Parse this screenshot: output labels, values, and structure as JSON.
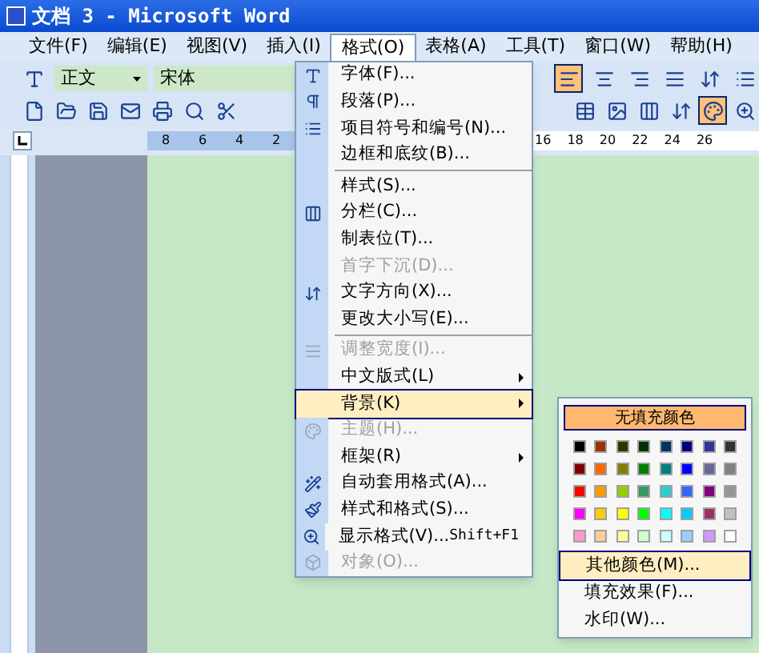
{
  "window": {
    "title": "文档 3 - Microsoft Word"
  },
  "menu_bar": [
    {
      "label": "文件(F)",
      "selected": false
    },
    {
      "label": "编辑(E)",
      "selected": false
    },
    {
      "label": "视图(V)",
      "selected": false
    },
    {
      "label": "插入(I)",
      "selected": false
    },
    {
      "label": "格式(O)",
      "selected": true
    },
    {
      "label": "表格(A)",
      "selected": false
    },
    {
      "label": "工具(T)",
      "selected": false
    },
    {
      "label": "窗口(W)",
      "selected": false
    },
    {
      "label": "帮助(H)",
      "selected": false
    }
  ],
  "formatting_toolbar": {
    "style": "正文",
    "font": "宋体"
  },
  "ruler": {
    "left_numbers": [
      "8",
      "6",
      "4",
      "2"
    ],
    "right_numbers": [
      "16",
      "18",
      "20",
      "22",
      "24",
      "26"
    ]
  },
  "format_menu": [
    {
      "kind": "item",
      "label": "字体(F)...",
      "disabled": false,
      "submenu": false,
      "selected": false
    },
    {
      "kind": "item",
      "label": "段落(P)...",
      "disabled": false,
      "submenu": false,
      "selected": false
    },
    {
      "kind": "item",
      "label": "项目符号和编号(N)...",
      "disabled": false,
      "submenu": false,
      "selected": false
    },
    {
      "kind": "item",
      "label": "边框和底纹(B)...",
      "disabled": false,
      "submenu": false,
      "selected": false
    },
    {
      "kind": "separator"
    },
    {
      "kind": "item",
      "label": "样式(S)...",
      "disabled": false,
      "submenu": false,
      "selected": false
    },
    {
      "kind": "item",
      "label": "分栏(C)...",
      "disabled": false,
      "submenu": false,
      "selected": false
    },
    {
      "kind": "item",
      "label": "制表位(T)...",
      "disabled": false,
      "submenu": false,
      "selected": false
    },
    {
      "kind": "item",
      "label": "首字下沉(D)...",
      "disabled": true,
      "submenu": false,
      "selected": false
    },
    {
      "kind": "item",
      "label": "文字方向(X)...",
      "disabled": false,
      "submenu": false,
      "selected": false
    },
    {
      "kind": "item",
      "label": "更改大小写(E)...",
      "disabled": false,
      "submenu": false,
      "selected": false
    },
    {
      "kind": "separator"
    },
    {
      "kind": "item",
      "label": "调整宽度(I)...",
      "disabled": true,
      "submenu": false,
      "selected": false
    },
    {
      "kind": "item",
      "label": "中文版式(L)",
      "disabled": false,
      "submenu": true,
      "selected": false
    },
    {
      "kind": "item",
      "label": "背景(K)",
      "disabled": false,
      "submenu": true,
      "selected": true
    },
    {
      "kind": "item",
      "label": "主题(H)...",
      "disabled": true,
      "submenu": false,
      "selected": false
    },
    {
      "kind": "item",
      "label": "框架(R)",
      "disabled": false,
      "submenu": true,
      "selected": false
    },
    {
      "kind": "item",
      "label": "自动套用格式(A)...",
      "disabled": false,
      "submenu": false,
      "selected": false
    },
    {
      "kind": "item",
      "label": "样式和格式(S)...",
      "disabled": false,
      "submenu": false,
      "selected": false
    },
    {
      "kind": "item",
      "label": "显示格式(V)...",
      "shortcut": "Shift+F1",
      "disabled": false,
      "submenu": false,
      "selected": false
    },
    {
      "kind": "item",
      "label": "对象(O)...",
      "disabled": true,
      "submenu": false,
      "selected": false
    }
  ],
  "background_menu": {
    "no_fill": "无填充颜色",
    "swatches": [
      {
        "color": "#000000"
      },
      {
        "color": "#993300"
      },
      {
        "color": "#333300"
      },
      {
        "color": "#003300"
      },
      {
        "color": "#003366"
      },
      {
        "color": "#000080"
      },
      {
        "color": "#333399"
      },
      {
        "color": "#333333"
      },
      {
        "color": "#800000"
      },
      {
        "color": "#ff6600"
      },
      {
        "color": "#808000"
      },
      {
        "color": "#008000"
      },
      {
        "color": "#008080"
      },
      {
        "color": "#0000ff"
      },
      {
        "color": "#666699"
      },
      {
        "color": "#808080"
      },
      {
        "color": "#ff0000"
      },
      {
        "color": "#ff9900"
      },
      {
        "color": "#99cc00"
      },
      {
        "color": "#339966"
      },
      {
        "color": "#33cccc"
      },
      {
        "color": "#3366ff"
      },
      {
        "color": "#800080"
      },
      {
        "color": "#969696"
      },
      {
        "color": "#ff00ff"
      },
      {
        "color": "#ffcc00"
      },
      {
        "color": "#ffff00"
      },
      {
        "color": "#00ff00"
      },
      {
        "color": "#00ffff"
      },
      {
        "color": "#00ccff"
      },
      {
        "color": "#993366"
      },
      {
        "color": "#c0c0c0"
      },
      {
        "color": "#ff99cc"
      },
      {
        "color": "#ffcc99"
      },
      {
        "color": "#ffff99"
      },
      {
        "color": "#ccffcc"
      },
      {
        "color": "#ccffff"
      },
      {
        "color": "#99ccff"
      },
      {
        "color": "#cc99ff"
      },
      {
        "color": "#ffffff"
      }
    ],
    "items": [
      {
        "label": "其他颜色(M)...",
        "selected": true
      },
      {
        "label": "填充效果(F)...",
        "selected": false
      },
      {
        "label": "水印(W)...",
        "selected": false
      }
    ]
  }
}
